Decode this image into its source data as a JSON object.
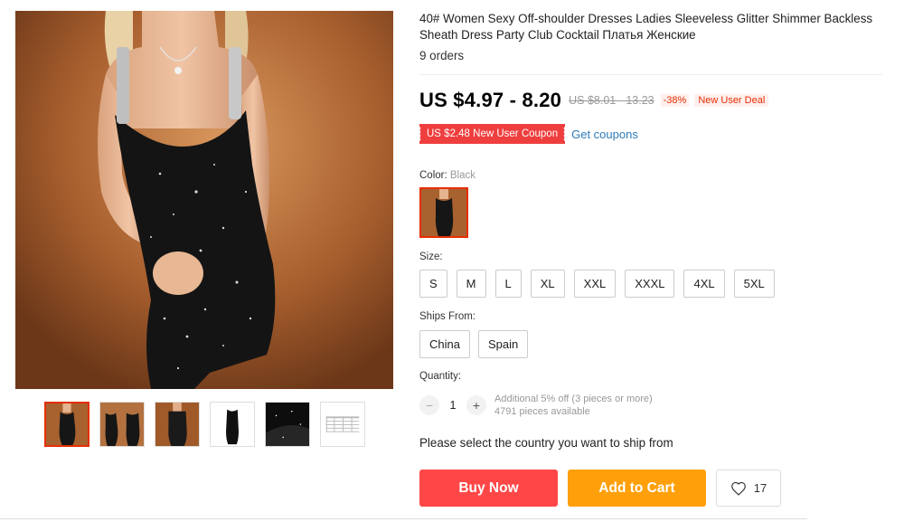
{
  "product": {
    "title": "40# Women Sexy Off-shoulder Dresses Ladies Sleeveless Glitter Shimmer Backless Sheath Dress Party Club Cocktail Платья Женские",
    "orders": "9 orders"
  },
  "price": {
    "current": "US $4.97 - 8.20",
    "original": "US $8.01 - 13.23",
    "discount": "-38%",
    "deal_badge": "New User Deal"
  },
  "coupon": {
    "label": "US $2.48 New User Coupon",
    "link": "Get coupons"
  },
  "color": {
    "label": "Color:",
    "selected": "Black"
  },
  "size": {
    "label": "Size:",
    "options": [
      "S",
      "M",
      "L",
      "XL",
      "XXL",
      "XXXL",
      "4XL",
      "5XL"
    ]
  },
  "ships_from": {
    "label": "Ships From:",
    "options": [
      "China",
      "Spain"
    ]
  },
  "quantity": {
    "label": "Quantity:",
    "minus": "−",
    "value": "1",
    "plus": "+",
    "note": "Additional 5% off (3 pieces or more)",
    "available": "4791 pieces available"
  },
  "ship_message": "Please select the country you want to ship from",
  "actions": {
    "buy_now": "Buy Now",
    "add_to_cart": "Add to Cart",
    "wishlist_count": "17"
  },
  "gallery": {
    "thumbnails": [
      "dress-front-photo",
      "dress-two-views-photo",
      "dress-back-photo",
      "dress-white-background-photo",
      "fabric-closeup-photo",
      "size-chart-photo"
    ],
    "selected_index": 0
  },
  "colors": {
    "accent": "#e62e04",
    "buy_button": "#ff4747",
    "cart_button": "#ffa00a",
    "link": "#2e7bb8",
    "coupon": "#ef3e3e"
  }
}
